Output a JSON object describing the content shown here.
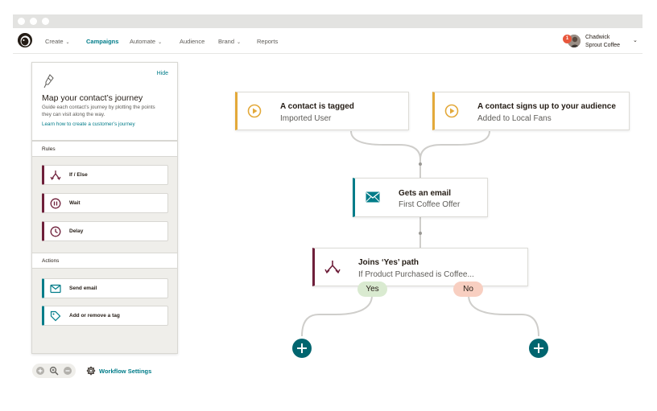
{
  "nav": {
    "items": [
      {
        "label": "Create",
        "chevron": true
      },
      {
        "label": "Campaigns",
        "chevron": false,
        "active": true
      },
      {
        "label": "Automate",
        "chevron": true
      },
      {
        "label": "Audience",
        "chevron": false
      },
      {
        "label": "Brand",
        "chevron": true
      },
      {
        "label": "Reports",
        "chevron": false
      }
    ],
    "chevron_glyph": "⌄",
    "profile": {
      "notification_count": "1",
      "name": "Chadwick",
      "org": "Sprout Coffee"
    }
  },
  "panel": {
    "hide_label": "Hide",
    "title": "Map your contact’s journey",
    "description": "Guide each contact’s journey by plotting the points they can visit along the way.",
    "link": "Learn how to create a customer’s journey",
    "rules_header": "Rules",
    "rules": [
      {
        "label": "If / Else",
        "icon": "branch-icon"
      },
      {
        "label": "Wait",
        "icon": "pause-icon"
      },
      {
        "label": "Delay",
        "icon": "clock-icon"
      }
    ],
    "actions_header": "Actions",
    "actions": [
      {
        "label": "Send email",
        "icon": "envelope-icon"
      },
      {
        "label": "Add or remove a tag",
        "icon": "tag-icon"
      }
    ]
  },
  "tools": {
    "workflow_settings": "Workflow Settings"
  },
  "flow": {
    "triggers": [
      {
        "title": "A contact is tagged",
        "subtitle": "Imported User",
        "icon": "play-icon"
      },
      {
        "title": "A contact signs up to your audience",
        "subtitle": "Added to Local Fans",
        "icon": "play-icon"
      }
    ],
    "email": {
      "title": "Gets an  email",
      "subtitle": "First Coffee Offer",
      "icon": "envelope-icon"
    },
    "ifelse": {
      "title": "Joins ‘Yes’ path",
      "subtitle": "If Product Purchased is Coffee...",
      "icon": "branch-icon"
    },
    "yes_label": "Yes",
    "no_label": "No"
  },
  "colors": {
    "accent": "#007c89",
    "trigger": "#e3a93a",
    "rule": "#6e1f3a",
    "yes": "#d9ead0",
    "no": "#f8cfc1"
  }
}
